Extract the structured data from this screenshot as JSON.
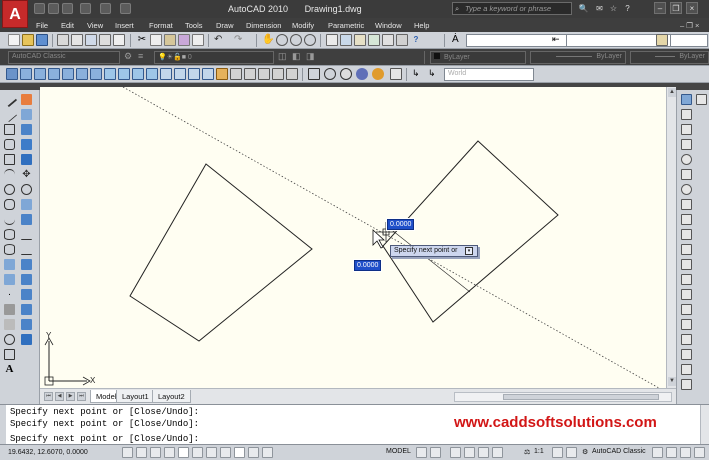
{
  "titlebar": {
    "app_name": "AutoCAD 2010",
    "doc_name": "Drawing1.dwg",
    "search_placeholder": "Type a keyword or phrase",
    "logo": "A"
  },
  "menu": [
    "File",
    "Edit",
    "View",
    "Insert",
    "Format",
    "Tools",
    "Draw",
    "Dimension",
    "Modify",
    "Parametric",
    "Window",
    "Help"
  ],
  "toolbars": {
    "workspace": "AutoCAD Classic",
    "layer_value": "0",
    "color": "ByLayer",
    "linetype": "ByLayer",
    "lineweight": "ByLayer",
    "ucs": "World"
  },
  "drawing": {
    "ucs_x_label": "X",
    "ucs_y_label": "Y"
  },
  "dynamic_input": {
    "field_top": "0.0000",
    "field_bottom": "0.0000",
    "prompt": "Specify next point or"
  },
  "layout_tabs": [
    "Model",
    "Layout1",
    "Layout2"
  ],
  "command_history": [
    "Specify next point or [Close/Undo]:",
    "Specify next point or [Close/Undo]:",
    "Specify next point or [Close/Undo]:"
  ],
  "watermark": "www.caddsoftsolutions.com",
  "status": {
    "coordinates": "19.6432, 12.6070, 0.0000",
    "space": "MODEL",
    "scale": "1:1",
    "workspace": "AutoCAD Classic"
  },
  "colors": {
    "canvas_bg": "#fffef2",
    "accent_red": "#d21616",
    "toolbar_bg": "#cfd3d9"
  }
}
